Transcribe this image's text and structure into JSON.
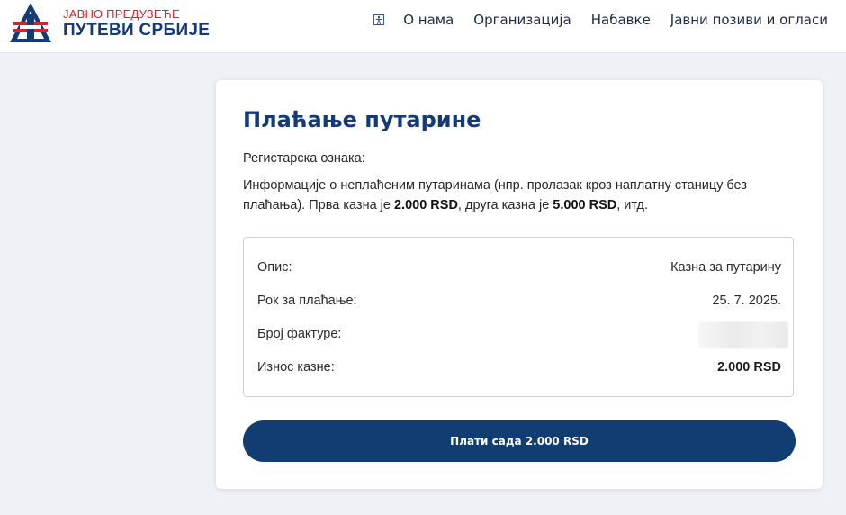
{
  "header": {
    "logo": {
      "line1": "ЈАВНО ПРЕДУЗЕЋЕ",
      "line2": "ПУТЕВИ СРБИЈЕ",
      "icon": "putevi-srbije-logo"
    },
    "nav_icon": "accessibility-icon",
    "nav": [
      {
        "label": "О нама"
      },
      {
        "label": "Организација"
      },
      {
        "label": "Набавке"
      },
      {
        "label": "Јавни позиви и огласи"
      }
    ]
  },
  "card": {
    "title": "Плаћање путарине",
    "registration_label": "Регистарска ознака:",
    "info": {
      "part1": "Информације о неплаћеним путаринама (нпр. пролазак кроз наплатну станицу без плаћања). Прва казна је ",
      "amount1": "2.000 RSD",
      "part2": ", друга казна је ",
      "amount2": "5.000 RSD",
      "part3": ", итд."
    },
    "details": [
      {
        "label": "Опис:",
        "value": "Казна за путарину"
      },
      {
        "label": "Рок за плаћање:",
        "value": "25. 7. 2025."
      },
      {
        "label": "Број фактуре:",
        "value": ""
      },
      {
        "label": "Износ казне:",
        "value": "2.000 RSD"
      }
    ],
    "pay_button": "Плати сада 2.000 RSD"
  },
  "colors": {
    "brand_blue": "#143a78",
    "brand_red": "#d4242d",
    "button": "#123d72",
    "page_bg": "#eef1f5"
  }
}
